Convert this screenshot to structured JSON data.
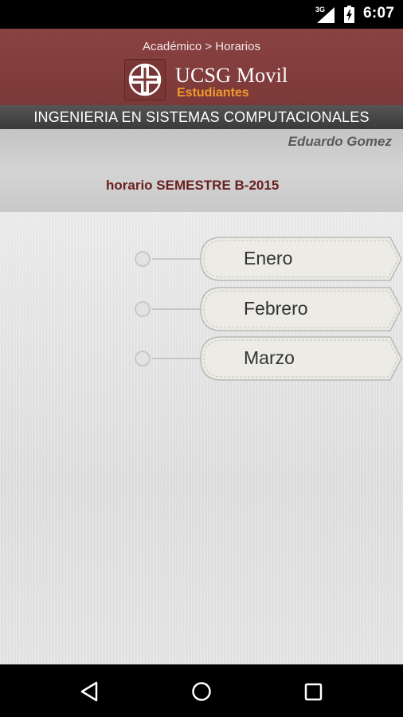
{
  "status_bar": {
    "network_label": "3G",
    "time": "6:07",
    "icons": [
      "signal-icon",
      "battery-icon"
    ]
  },
  "header": {
    "breadcrumb": "Académico > Horarios",
    "brand_name": "UCSG Movil",
    "brand_subtitle": "Estudiantes",
    "logo_icon": "university-cross-logo",
    "background_color": "#843f3f",
    "subtitle_color": "#f39a2c"
  },
  "career": {
    "name": "INGENIERIA EN SISTEMAS COMPUTACIONALES"
  },
  "student": {
    "name": "Eduardo Gomez"
  },
  "schedule": {
    "title": "horario SEMESTRE B-2015",
    "title_color": "#6a1f1f",
    "months": [
      {
        "label": "Enero"
      },
      {
        "label": "Febrero"
      },
      {
        "label": "Marzo"
      }
    ]
  },
  "navigation": {
    "buttons": [
      "back-icon",
      "home-icon",
      "recents-icon"
    ]
  }
}
